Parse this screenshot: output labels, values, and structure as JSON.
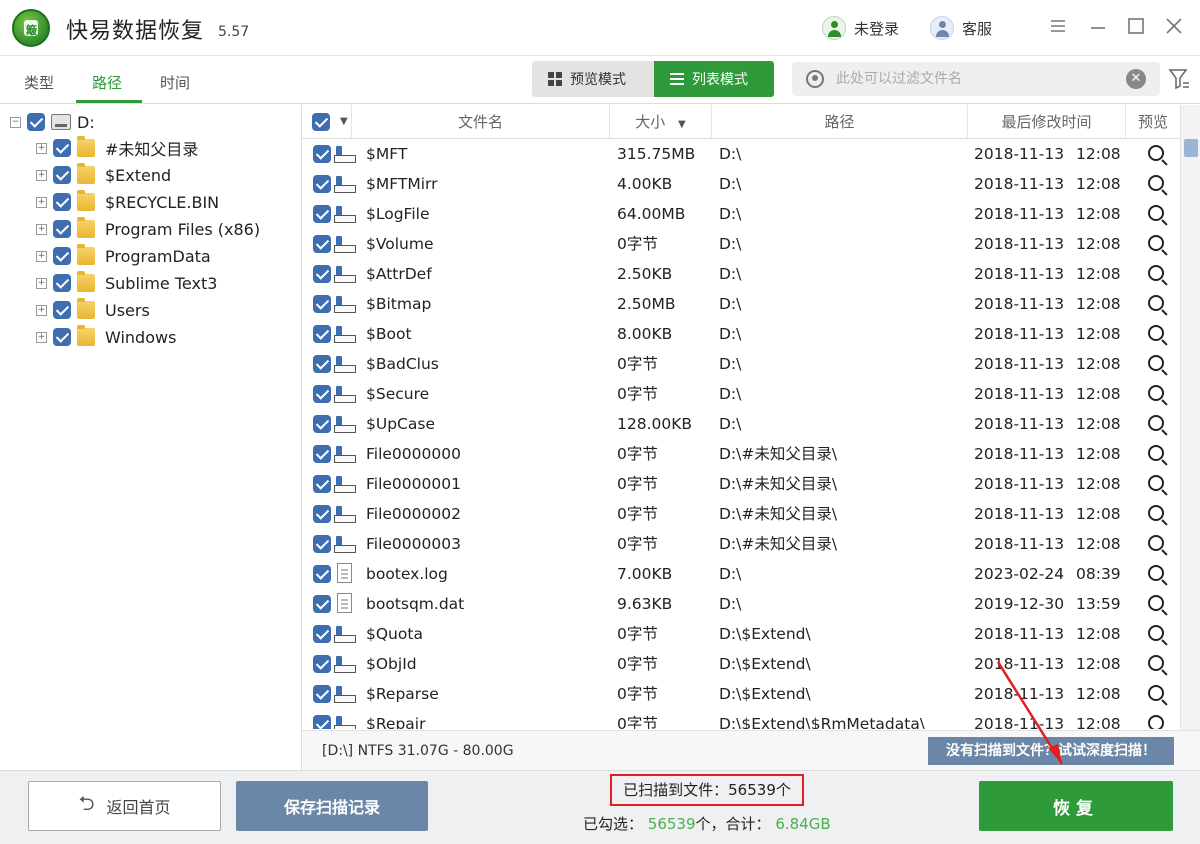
{
  "app": {
    "title": "快易数据恢复",
    "version": "5.57",
    "logo_text": "簸",
    "login_label": "未登录",
    "service_label": "客服"
  },
  "tabs": [
    {
      "label": "类型",
      "active": false
    },
    {
      "label": "路径",
      "active": true
    },
    {
      "label": "时间",
      "active": false
    }
  ],
  "view_modes": {
    "preview_label": "预览模式",
    "list_label": "列表模式",
    "active": "list"
  },
  "filter": {
    "placeholder": "此处可以过滤文件名"
  },
  "tree": {
    "root": "D:",
    "children": [
      "#未知父目录",
      "$Extend",
      "$RECYCLE.BIN",
      "Program Files (x86)",
      "ProgramData",
      "Sublime Text3",
      "Users",
      "Windows"
    ]
  },
  "table": {
    "headers": {
      "name": "文件名",
      "size": "大小",
      "path": "路径",
      "modified": "最后修改时间",
      "preview": "预览"
    },
    "rows": [
      {
        "name": "$MFT",
        "size": "315.75MB",
        "path": "D:\\",
        "date": "2018-11-13",
        "time": "12:08",
        "icon": "system-file-icon"
      },
      {
        "name": "$MFTMirr",
        "size": "4.00KB",
        "path": "D:\\",
        "date": "2018-11-13",
        "time": "12:08",
        "icon": "system-file-icon"
      },
      {
        "name": "$LogFile",
        "size": "64.00MB",
        "path": "D:\\",
        "date": "2018-11-13",
        "time": "12:08",
        "icon": "system-file-icon"
      },
      {
        "name": "$Volume",
        "size": "0字节",
        "path": "D:\\",
        "date": "2018-11-13",
        "time": "12:08",
        "icon": "system-file-icon"
      },
      {
        "name": "$AttrDef",
        "size": "2.50KB",
        "path": "D:\\",
        "date": "2018-11-13",
        "time": "12:08",
        "icon": "system-file-icon"
      },
      {
        "name": "$Bitmap",
        "size": "2.50MB",
        "path": "D:\\",
        "date": "2018-11-13",
        "time": "12:08",
        "icon": "system-file-icon"
      },
      {
        "name": "$Boot",
        "size": "8.00KB",
        "path": "D:\\",
        "date": "2018-11-13",
        "time": "12:08",
        "icon": "system-file-icon"
      },
      {
        "name": "$BadClus",
        "size": "0字节",
        "path": "D:\\",
        "date": "2018-11-13",
        "time": "12:08",
        "icon": "system-file-icon"
      },
      {
        "name": "$Secure",
        "size": "0字节",
        "path": "D:\\",
        "date": "2018-11-13",
        "time": "12:08",
        "icon": "system-file-icon"
      },
      {
        "name": "$UpCase",
        "size": "128.00KB",
        "path": "D:\\",
        "date": "2018-11-13",
        "time": "12:08",
        "icon": "system-file-icon"
      },
      {
        "name": "File0000000",
        "size": "0字节",
        "path": "D:\\#未知父目录\\",
        "date": "2018-11-13",
        "time": "12:08",
        "icon": "system-file-icon"
      },
      {
        "name": "File0000001",
        "size": "0字节",
        "path": "D:\\#未知父目录\\",
        "date": "2018-11-13",
        "time": "12:08",
        "icon": "system-file-icon"
      },
      {
        "name": "File0000002",
        "size": "0字节",
        "path": "D:\\#未知父目录\\",
        "date": "2018-11-13",
        "time": "12:08",
        "icon": "system-file-icon"
      },
      {
        "name": "File0000003",
        "size": "0字节",
        "path": "D:\\#未知父目录\\",
        "date": "2018-11-13",
        "time": "12:08",
        "icon": "system-file-icon"
      },
      {
        "name": "bootex.log",
        "size": "7.00KB",
        "path": "D:\\",
        "date": "2023-02-24",
        "time": "08:39",
        "icon": "document-icon"
      },
      {
        "name": "bootsqm.dat",
        "size": "9.63KB",
        "path": "D:\\",
        "date": "2019-12-30",
        "time": "13:59",
        "icon": "document-icon"
      },
      {
        "name": "$Quota",
        "size": "0字节",
        "path": "D:\\$Extend\\",
        "date": "2018-11-13",
        "time": "12:08",
        "icon": "system-file-icon"
      },
      {
        "name": "$ObjId",
        "size": "0字节",
        "path": "D:\\$Extend\\",
        "date": "2018-11-13",
        "time": "12:08",
        "icon": "system-file-icon"
      },
      {
        "name": "$Reparse",
        "size": "0字节",
        "path": "D:\\$Extend\\",
        "date": "2018-11-13",
        "time": "12:08",
        "icon": "system-file-icon"
      },
      {
        "name": "$Repair",
        "size": "0字节",
        "path": "D:\\$Extend\\$RmMetadata\\",
        "date": "2018-11-13",
        "time": "12:08",
        "icon": "system-file-icon"
      }
    ]
  },
  "disk_info": "[D:\\] NTFS 31.07G - 80.00G",
  "deep_scan_label": "没有扫描到文件？试试深度扫描！",
  "bottom": {
    "back_label": "返回首页",
    "save_label": "保存扫描记录",
    "scanned_label": "已扫描到文件：",
    "scanned_count": "56539个",
    "selected_label": "已勾选：",
    "selected_count": "56539",
    "selected_unit": "个，合计：",
    "total_size": "6.84GB",
    "recover_label": "恢复"
  },
  "colors": {
    "accent_green": "#2f9a3a",
    "checkbox_blue": "#3e6db0",
    "annotation_red": "#e02020",
    "secondary_button": "#6b87a8"
  }
}
